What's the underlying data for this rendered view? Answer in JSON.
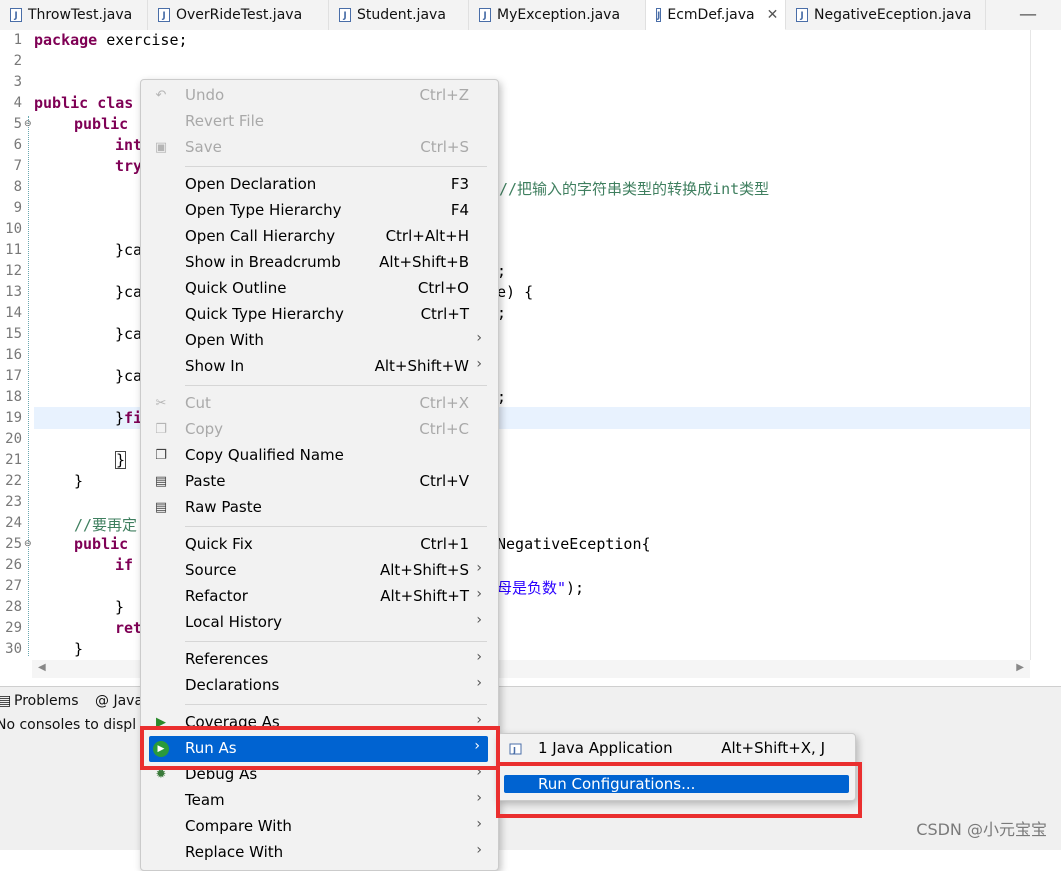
{
  "tabs": [
    {
      "label": "ThrowTest.java"
    },
    {
      "label": "OverRideTest.java"
    },
    {
      "label": "Student.java"
    },
    {
      "label": "MyException.java"
    },
    {
      "label": "EcmDef.java"
    },
    {
      "label": "NegativeEception.java"
    }
  ],
  "tab_close_glyph": "✕",
  "tab_min_glyph": "—",
  "file_icon_glyph": "J",
  "editor": {
    "line_numbers": [
      "1",
      "2",
      "3",
      "4",
      "5",
      "6",
      "7",
      "8",
      "9",
      "10",
      "11",
      "12",
      "13",
      "14",
      "15",
      "16",
      "17",
      "18",
      "19",
      "20",
      "21",
      "22",
      "23",
      "24",
      "25",
      "26",
      "27",
      "28",
      "29",
      "30"
    ],
    "lines": {
      "l1_kw": "package",
      "l1_rest": " exercise;",
      "l4_kw": "public",
      "l4_rest": " clas",
      "l5_kw": "public",
      "l6_kw": "int",
      "l7_kw": "try",
      "l8_comment": "//把输入的字符串类型的转换成int类型",
      "l11": "}ca",
      "l12": ";",
      "l13a": "}ca",
      "l13b": "e) {",
      "l14": ";",
      "l15": "}ca",
      "l17": "}ca",
      "l18": ";",
      "l19_brace": "}",
      "l19_kw": "fi",
      "l21": "}",
      "l22": "}",
      "l24_comment": "//要再定",
      "l25_kw": "public",
      "l25_rest": "NegativeEception{",
      "l26_kw": "if",
      "l27_str": "母是负数\"",
      "l27_rest": ");",
      "l28": "}",
      "l29_kw": "ret",
      "l30": "}"
    }
  },
  "scroll_left_glyph": "◀",
  "scroll_right_glyph": "▶",
  "bottom_panel": {
    "tab_problems": "Problems",
    "tab_javadoc": "@ Java",
    "console_message": "No consoles to displ",
    "watermark": "CSDN @小元宝宝"
  },
  "context_menu": {
    "undo": {
      "label": "Undo",
      "shortcut": "Ctrl+Z"
    },
    "revert": {
      "label": "Revert File"
    },
    "save": {
      "label": "Save",
      "shortcut": "Ctrl+S"
    },
    "open_declaration": {
      "label": "Open Declaration",
      "shortcut": "F3"
    },
    "open_type_hierarchy": {
      "label": "Open Type Hierarchy",
      "shortcut": "F4"
    },
    "open_call_hierarchy": {
      "label": "Open Call Hierarchy",
      "shortcut": "Ctrl+Alt+H"
    },
    "show_in_breadcrumb": {
      "label": "Show in Breadcrumb",
      "shortcut": "Alt+Shift+B"
    },
    "quick_outline": {
      "label": "Quick Outline",
      "shortcut": "Ctrl+O"
    },
    "quick_type_hierarchy": {
      "label": "Quick Type Hierarchy",
      "shortcut": "Ctrl+T"
    },
    "open_with": {
      "label": "Open With"
    },
    "show_in": {
      "label": "Show In",
      "shortcut": "Alt+Shift+W"
    },
    "cut": {
      "label": "Cut",
      "shortcut": "Ctrl+X"
    },
    "copy": {
      "label": "Copy",
      "shortcut": "Ctrl+C"
    },
    "copy_qualified": {
      "label": "Copy Qualified Name"
    },
    "paste": {
      "label": "Paste",
      "shortcut": "Ctrl+V"
    },
    "raw_paste": {
      "label": "Raw Paste"
    },
    "quick_fix": {
      "label": "Quick Fix",
      "shortcut": "Ctrl+1"
    },
    "source": {
      "label": "Source",
      "shortcut": "Alt+Shift+S"
    },
    "refactor": {
      "label": "Refactor",
      "shortcut": "Alt+Shift+T"
    },
    "local_history": {
      "label": "Local History"
    },
    "references": {
      "label": "References"
    },
    "declarations": {
      "label": "Declarations"
    },
    "coverage_as": {
      "label": "Coverage As"
    },
    "run_as": {
      "label": "Run As"
    },
    "debug_as": {
      "label": "Debug As"
    },
    "team": {
      "label": "Team"
    },
    "compare_with": {
      "label": "Compare With"
    },
    "replace_with": {
      "label": "Replace With"
    },
    "submenu_arrow": "›"
  },
  "run_as_submenu": {
    "java_app": {
      "label": "1 Java Application",
      "shortcut": "Alt+Shift+X, J"
    },
    "run_configurations": {
      "label": "Run Configurations..."
    }
  },
  "icons": {
    "undo": "↶",
    "save": "▣",
    "cut": "✂",
    "copy": "❐",
    "paste": "▤",
    "debug": "✹",
    "run": "▶"
  },
  "colors": {
    "selection": "#0063d1",
    "highlight_box": "#ea2f2f",
    "keyword": "#7f0055",
    "comment": "#3f7f5f",
    "string": "#2a00ff"
  }
}
